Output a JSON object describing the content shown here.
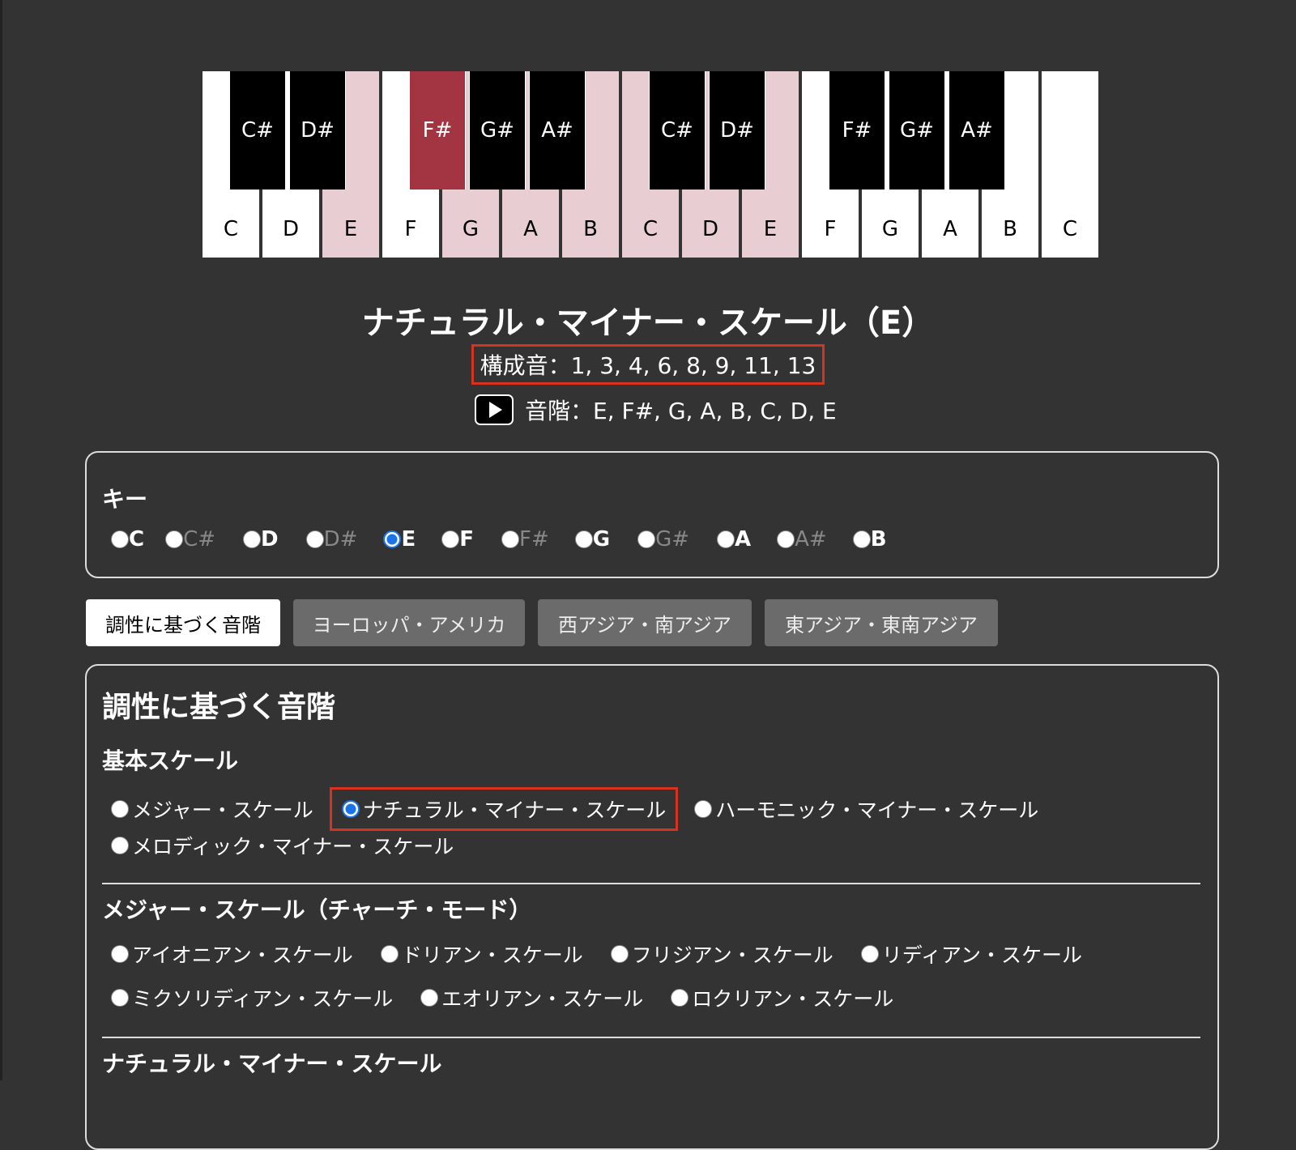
{
  "piano": {
    "white_keys": [
      {
        "label": "C",
        "highlighted": false
      },
      {
        "label": "D",
        "highlighted": false
      },
      {
        "label": "E",
        "highlighted": true
      },
      {
        "label": "F",
        "highlighted": false
      },
      {
        "label": "G",
        "highlighted": true
      },
      {
        "label": "A",
        "highlighted": true
      },
      {
        "label": "B",
        "highlighted": true
      },
      {
        "label": "C",
        "highlighted": true
      },
      {
        "label": "D",
        "highlighted": true
      },
      {
        "label": "E",
        "highlighted": true
      },
      {
        "label": "F",
        "highlighted": false
      },
      {
        "label": "G",
        "highlighted": false
      },
      {
        "label": "A",
        "highlighted": false
      },
      {
        "label": "B",
        "highlighted": false
      },
      {
        "label": "C",
        "highlighted": false
      }
    ],
    "black_keys": [
      {
        "label": "C#",
        "highlighted": false
      },
      {
        "label": "D#",
        "highlighted": false
      },
      {
        "label": "F#",
        "highlighted": true
      },
      {
        "label": "G#",
        "highlighted": false
      },
      {
        "label": "A#",
        "highlighted": false
      },
      {
        "label": "C#",
        "highlighted": false
      },
      {
        "label": "D#",
        "highlighted": false
      },
      {
        "label": "F#",
        "highlighted": false
      },
      {
        "label": "G#",
        "highlighted": false
      },
      {
        "label": "A#",
        "highlighted": false
      }
    ],
    "colors": {
      "highlight_white": "#e8cdd2",
      "highlight_black": "#a33542"
    }
  },
  "scale_title": "ナチュラル・マイナー・スケール（E）",
  "composition": "構成音：1, 3, 4, 6, 8, 9, 11, 13",
  "scale_notes": "音階：E, F#, G, A, B, C, D, E",
  "play_icon": "play-icon",
  "key_section": {
    "label": "キー",
    "options": [
      {
        "label": "C",
        "sharp": false,
        "selected": false
      },
      {
        "label": "C#",
        "sharp": true,
        "selected": false
      },
      {
        "label": "D",
        "sharp": false,
        "selected": false
      },
      {
        "label": "D#",
        "sharp": true,
        "selected": false
      },
      {
        "label": "E",
        "sharp": false,
        "selected": true
      },
      {
        "label": "F",
        "sharp": false,
        "selected": false
      },
      {
        "label": "F#",
        "sharp": true,
        "selected": false
      },
      {
        "label": "G",
        "sharp": false,
        "selected": false
      },
      {
        "label": "G#",
        "sharp": true,
        "selected": false
      },
      {
        "label": "A",
        "sharp": false,
        "selected": false
      },
      {
        "label": "A#",
        "sharp": true,
        "selected": false
      },
      {
        "label": "B",
        "sharp": false,
        "selected": false
      }
    ]
  },
  "tabs": [
    {
      "label": "調性に基づく音階",
      "active": true
    },
    {
      "label": "ヨーロッパ・アメリカ",
      "active": false
    },
    {
      "label": "西アジア・南アジア",
      "active": false
    },
    {
      "label": "東アジア・東南アジア",
      "active": false
    }
  ],
  "main": {
    "heading": "調性に基づく音階",
    "basic": {
      "heading": "基本スケール",
      "options": [
        {
          "label": "メジャー・スケール",
          "selected": false
        },
        {
          "label": "ナチュラル・マイナー・スケール",
          "selected": true
        },
        {
          "label": "ハーモニック・マイナー・スケール",
          "selected": false
        },
        {
          "label": "メロディック・マイナー・スケール",
          "selected": false
        }
      ]
    },
    "church": {
      "heading": "メジャー・スケール（チャーチ・モード）",
      "options": [
        {
          "label": "アイオニアン・スケール",
          "selected": false
        },
        {
          "label": "ドリアン・スケール",
          "selected": false
        },
        {
          "label": "フリジアン・スケール",
          "selected": false
        },
        {
          "label": "リディアン・スケール",
          "selected": false
        },
        {
          "label": "ミクソリディアン・スケール",
          "selected": false
        },
        {
          "label": "エオリアン・スケール",
          "selected": false
        },
        {
          "label": "ロクリアン・スケール",
          "selected": false
        }
      ]
    },
    "natural_minor_heading": "ナチュラル・マイナー・スケール"
  }
}
